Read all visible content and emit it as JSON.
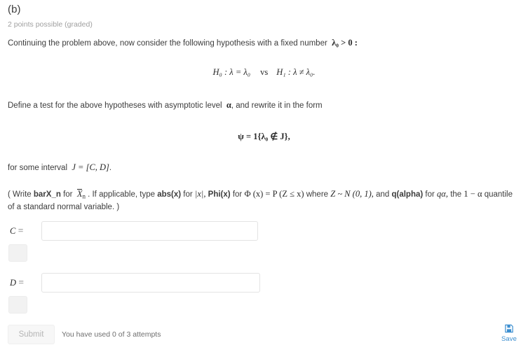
{
  "problem": {
    "part_label": "(b)",
    "points_line": "2 points possible (graded)",
    "intro_before_math": "Continuing the problem above, now consider the following hypothesis with a fixed number",
    "intro_math": "λ₀ > 0 :",
    "hypothesis_null": "H₀ : λ = λ₀",
    "hypothesis_vs": "vs",
    "hypothesis_alt": "H₁ : λ ≠ λ₀.",
    "define_before_math": "Define a test for the above hypotheses with asymptotic level",
    "define_math_alpha": "α",
    "define_after_math": ", and rewrite it in the form",
    "psi_equation": "ψ = 1{λ₀ ∉ J},",
    "interval_prefix": "for some interval",
    "interval_math": "J = [C, D]",
    "interval_suffix": ".",
    "note": {
      "open_paren": "(",
      "write": "Write",
      "barxn_code": "barX_n",
      "for1": "for",
      "barxn_math": "X̅ₙ",
      "if_applicable": ". If applicable, type",
      "abs_code": "abs(x)",
      "for2": "for",
      "abs_math": "|x|,",
      "phi_code": "Phi(x)",
      "for3": "for",
      "phi_math": "Φ (x) = P (Z ≤ x)",
      "where": "where",
      "z_math": "Z ~ N (0, 1),",
      "and": "and",
      "q_code": "q(alpha)",
      "for4": "for",
      "q_math": "qα,",
      "the": "the",
      "one_minus_alpha": "1 − α",
      "second_line": "quantile of a standard normal variable. )"
    }
  },
  "answers": [
    {
      "label_var": "C",
      "label_eq": "=",
      "value": "",
      "placeholder": ""
    },
    {
      "label_var": "D",
      "label_eq": "=",
      "value": "",
      "placeholder": ""
    }
  ],
  "footer": {
    "submit_label": "Submit",
    "attempts_text": "You have used 0 of 3 attempts",
    "save_label": "Save",
    "save_icon": "floppy-disk-icon"
  },
  "colors": {
    "text": "#3c3c3c",
    "muted": "#a0a0a0",
    "accent_blue": "#3b8ed0",
    "input_border": "#e3e3e3",
    "disabled_bg": "#f7f7f7"
  }
}
